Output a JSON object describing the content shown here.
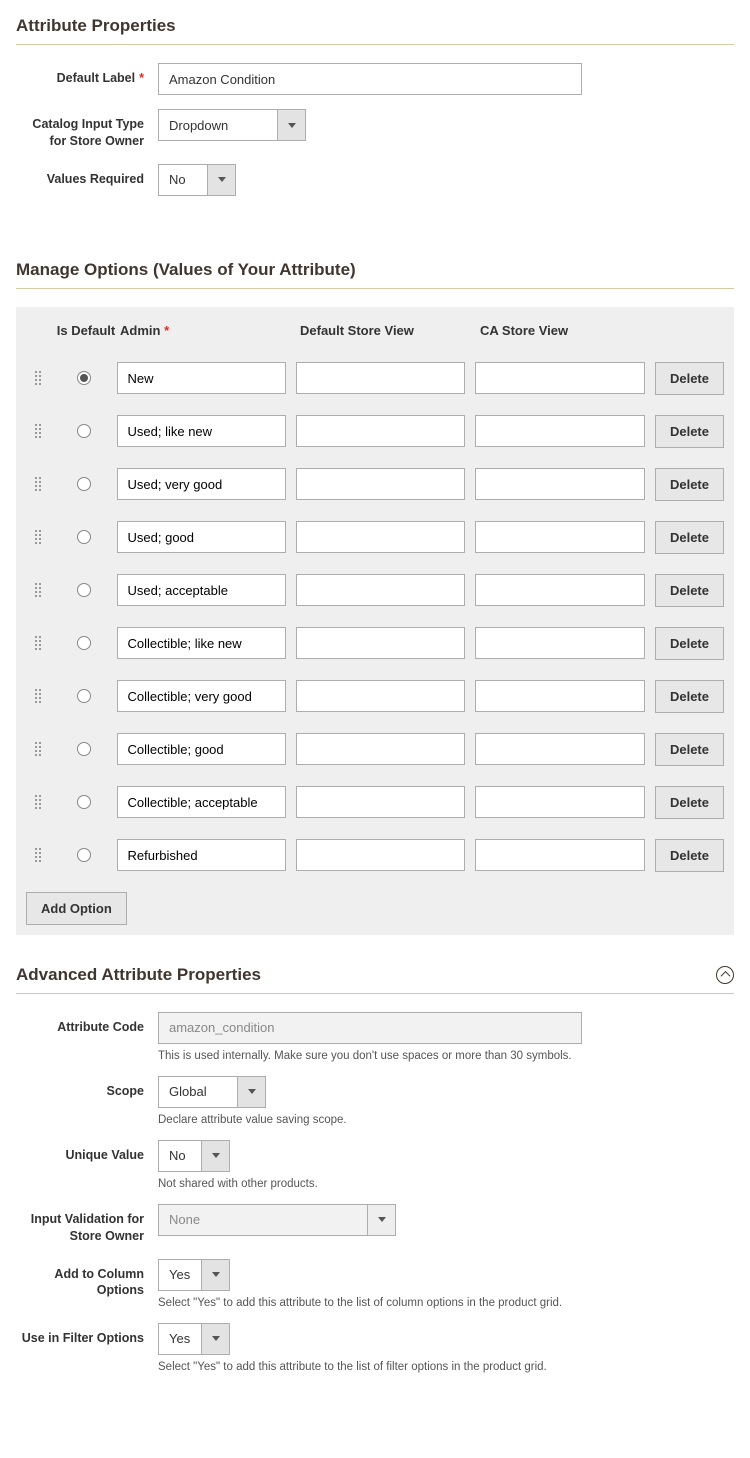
{
  "section_props": {
    "title": "Attribute Properties",
    "default_label": {
      "label": "Default Label",
      "value": "Amazon Condition",
      "required": true
    },
    "catalog_input": {
      "label": "Catalog Input Type for Store Owner",
      "value": "Dropdown"
    },
    "values_required": {
      "label": "Values Required",
      "value": "No"
    }
  },
  "section_options": {
    "title": "Manage Options (Values of Your Attribute)",
    "headers": {
      "is_default": "Is Default",
      "admin": "Admin",
      "default_view": "Default Store View",
      "ca_view": "CA Store View"
    },
    "rows": [
      {
        "admin": "New",
        "default_view": "",
        "ca_view": "",
        "is_default": true
      },
      {
        "admin": "Used; like new",
        "default_view": "",
        "ca_view": "",
        "is_default": false
      },
      {
        "admin": "Used; very good",
        "default_view": "",
        "ca_view": "",
        "is_default": false
      },
      {
        "admin": "Used; good",
        "default_view": "",
        "ca_view": "",
        "is_default": false
      },
      {
        "admin": "Used; acceptable",
        "default_view": "",
        "ca_view": "",
        "is_default": false
      },
      {
        "admin": "Collectible; like new",
        "default_view": "",
        "ca_view": "",
        "is_default": false
      },
      {
        "admin": "Collectible; very good",
        "default_view": "",
        "ca_view": "",
        "is_default": false
      },
      {
        "admin": "Collectible; good",
        "default_view": "",
        "ca_view": "",
        "is_default": false
      },
      {
        "admin": "Collectible; acceptable",
        "default_view": "",
        "ca_view": "",
        "is_default": false
      },
      {
        "admin": "Refurbished",
        "default_view": "",
        "ca_view": "",
        "is_default": false
      }
    ],
    "delete_label": "Delete",
    "add_option_label": "Add Option",
    "admin_required": true
  },
  "section_adv": {
    "title": "Advanced Attribute Properties",
    "attribute_code": {
      "label": "Attribute Code",
      "value": "amazon_condition",
      "note": "This is used internally. Make sure you don't use spaces or more than 30 symbols."
    },
    "scope": {
      "label": "Scope",
      "value": "Global",
      "note": "Declare attribute value saving scope."
    },
    "unique_value": {
      "label": "Unique Value",
      "value": "No",
      "note": "Not shared with other products."
    },
    "input_validation": {
      "label": "Input Validation for Store Owner",
      "value": "None"
    },
    "add_to_column": {
      "label": "Add to Column Options",
      "value": "Yes",
      "note": "Select \"Yes\" to add this attribute to the list of column options in the product grid."
    },
    "use_in_filter": {
      "label": "Use in Filter Options",
      "value": "Yes",
      "note": "Select \"Yes\" to add this attribute to the list of filter options in the product grid."
    }
  }
}
